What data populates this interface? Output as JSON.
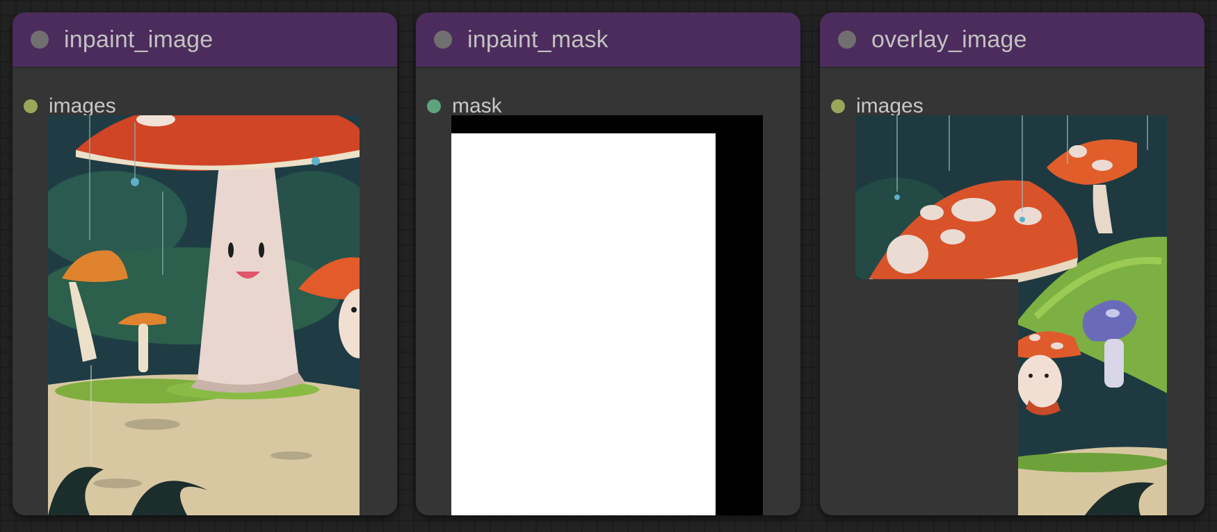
{
  "nodes": [
    {
      "title": "inpaint_image",
      "slot": {
        "label": "images",
        "color": "#9aa75a"
      }
    },
    {
      "title": "inpaint_mask",
      "slot": {
        "label": "mask",
        "color": "#5fa37d"
      }
    },
    {
      "title": "overlay_image",
      "slot": {
        "label": "images",
        "color": "#9aa75a"
      }
    }
  ],
  "colors": {
    "canvas_bg": "#222222",
    "node_bg": "#353535",
    "header_bg": "#4c2c5c",
    "title_text": "#c2c2c2"
  }
}
